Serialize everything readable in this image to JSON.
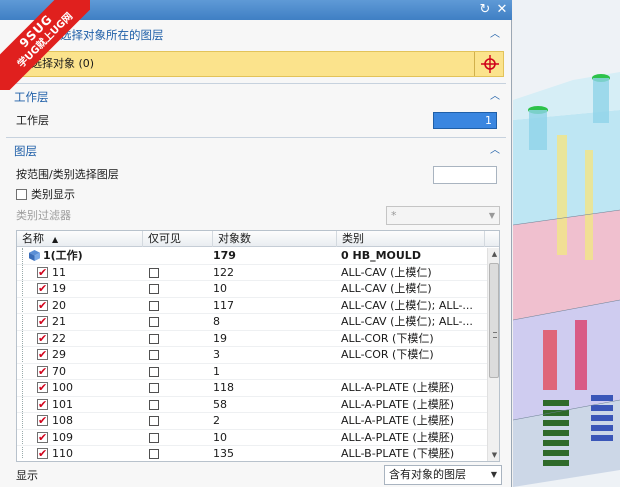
{
  "watermark": {
    "line1": "9SUG",
    "line2": "学UG就上UG网"
  },
  "titlebar": {
    "reset_icon": "reset-icon",
    "close_icon": "close-icon"
  },
  "sections": {
    "select_objects": {
      "title": "选择对象所在的图层",
      "select_label": "选择对象 (0)",
      "crosshair_icon": "crosshair-icon"
    },
    "work_layer": {
      "title": "工作层",
      "label": "工作层",
      "value": "1"
    },
    "layers": {
      "title": "图层",
      "range_label": "按范围/类别选择图层",
      "category_display_label": "类别显示",
      "category_display_checked": false,
      "filter_label": "类别过滤器",
      "filter_value": "*"
    }
  },
  "table": {
    "columns": {
      "name": "名称",
      "visible_only": "仅可见",
      "object_count": "对象数",
      "category": "类别"
    },
    "rows": [
      {
        "name": "1(工作)",
        "visible": "",
        "count": "179",
        "category": "0 HB_MOULD",
        "checked": null,
        "work": true
      },
      {
        "name": "11",
        "count": "122",
        "category": "ALL-CAV (上模仁)",
        "checked": true
      },
      {
        "name": "19",
        "count": "10",
        "category": "ALL-CAV (上模仁)",
        "checked": true
      },
      {
        "name": "20",
        "count": "117",
        "category": "ALL-CAV (上模仁); ALL-...",
        "checked": true
      },
      {
        "name": "21",
        "count": "8",
        "category": "ALL-CAV (上模仁); ALL-...",
        "checked": true
      },
      {
        "name": "22",
        "count": "19",
        "category": "ALL-COR (下模仁)",
        "checked": true
      },
      {
        "name": "29",
        "count": "3",
        "category": "ALL-COR (下模仁)",
        "checked": true
      },
      {
        "name": "70",
        "count": "1",
        "category": "",
        "checked": true
      },
      {
        "name": "100",
        "count": "118",
        "category": "ALL-A-PLATE (上模胚)",
        "checked": true
      },
      {
        "name": "101",
        "count": "58",
        "category": "ALL-A-PLATE (上模胚)",
        "checked": true
      },
      {
        "name": "108",
        "count": "2",
        "category": "ALL-A-PLATE (上模胚)",
        "checked": true
      },
      {
        "name": "109",
        "count": "10",
        "category": "ALL-A-PLATE (上模胚)",
        "checked": true
      },
      {
        "name": "110",
        "count": "135",
        "category": "ALL-B-PLATE (下模胚)",
        "checked": true
      }
    ]
  },
  "footer": {
    "show_label": "显示",
    "show_value": "含有对象的图层"
  },
  "colors": {
    "title_bar": "#3f7fc4",
    "section_title": "#1f5fa8",
    "select_highlight": "#fbe38c",
    "check_mark": "#d0021b",
    "work_layer_field": "#3a86e0"
  }
}
